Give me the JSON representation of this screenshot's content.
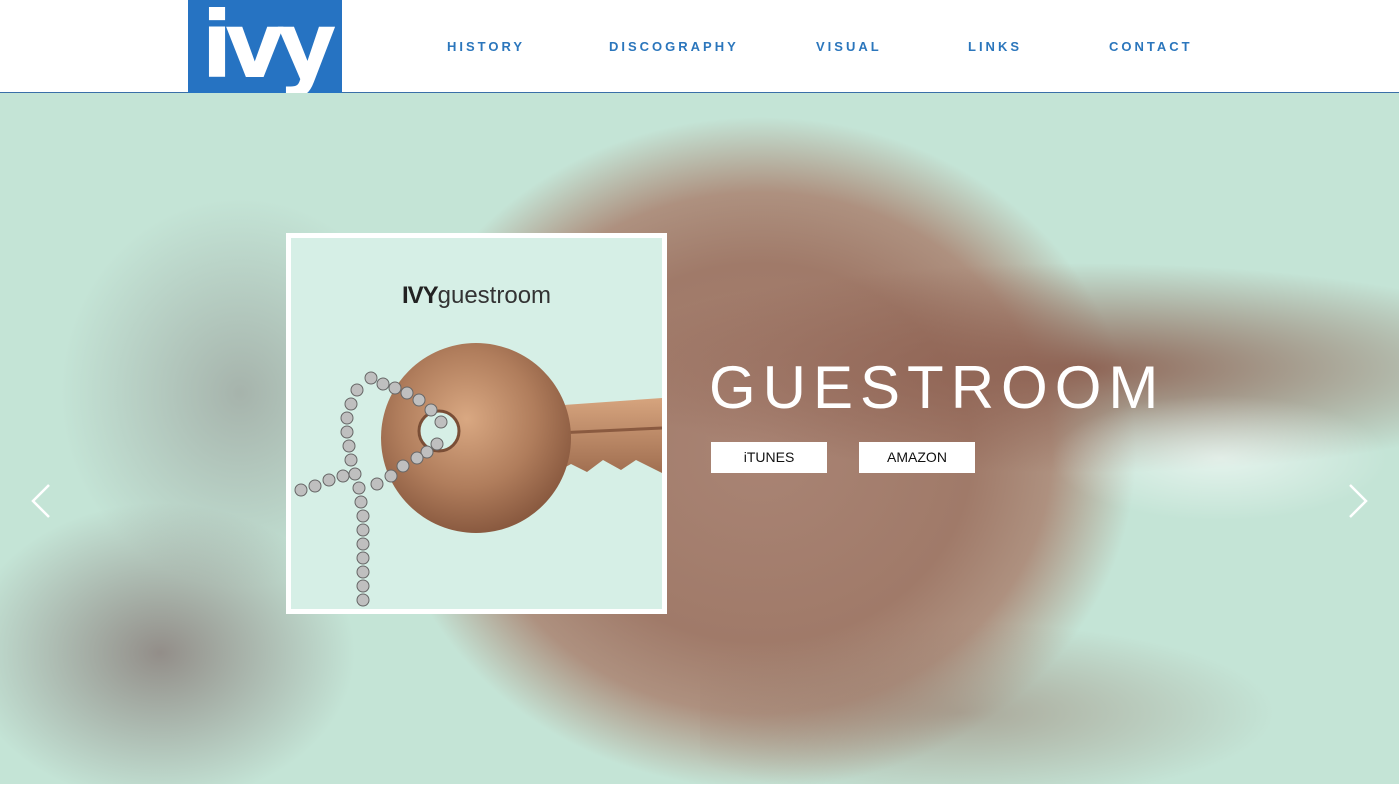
{
  "header": {
    "logo_text": "ivy",
    "nav": [
      "HISTORY",
      "DISCOGRAPHY",
      "VISUAL",
      "LINKS",
      "CONTACT"
    ]
  },
  "hero": {
    "album_brand_bold": "IVY",
    "album_brand_light": "guestroom",
    "title": "GUESTROOM",
    "buttons": [
      "iTUNES",
      "AMAZON"
    ],
    "prev_icon": "chevron-left-icon",
    "next_icon": "chevron-right-icon"
  },
  "colors": {
    "brand_blue": "#2673c2",
    "nav_blue": "#2b76bc",
    "mint_background": "#c4e4d6",
    "copper": "#a07a69"
  }
}
